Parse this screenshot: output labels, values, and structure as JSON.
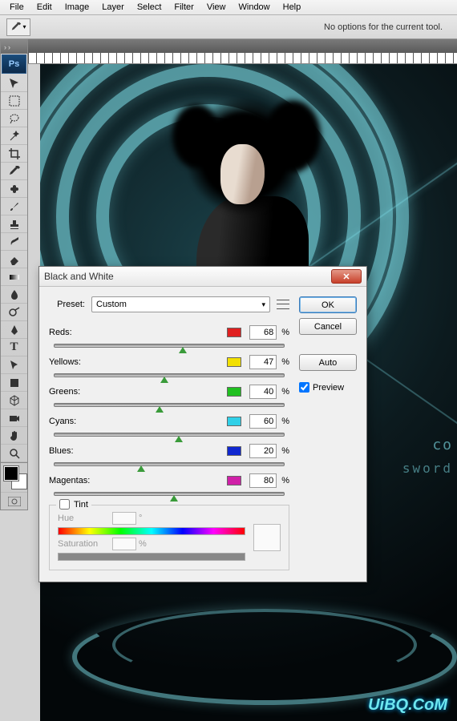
{
  "menu": [
    "File",
    "Edit",
    "Image",
    "Layer",
    "Select",
    "Filter",
    "View",
    "Window",
    "Help"
  ],
  "optionsBar": {
    "message": "No options for the current tool."
  },
  "dialog": {
    "title": "Black and White",
    "preset_label": "Preset:",
    "preset_value": "Custom",
    "rows": [
      {
        "label": "Reds:",
        "value": "68",
        "color": "#e02020"
      },
      {
        "label": "Yellows:",
        "value": "47",
        "color": "#f2e000"
      },
      {
        "label": "Greens:",
        "value": "40",
        "color": "#20c020"
      },
      {
        "label": "Cyans:",
        "value": "60",
        "color": "#30d0e8"
      },
      {
        "label": "Blues:",
        "value": "20",
        "color": "#1028d0"
      },
      {
        "label": "Magentas:",
        "value": "80",
        "color": "#d020a8"
      }
    ],
    "percent": "%",
    "tint_label": "Tint",
    "hue_label": "Hue",
    "sat_label": "Saturation",
    "degree": "°",
    "ok": "OK",
    "cancel": "Cancel",
    "auto": "Auto",
    "preview": "Preview"
  },
  "artwork": {
    "text1": "co",
    "text2": "sword",
    "watermark": "UiBQ.CoM"
  },
  "thumb_pos": {
    "Reds:": 56,
    "Yellows:": 48,
    "Greens:": 46,
    "Cyans:": 54,
    "Blues:": 38,
    "Magentas:": 52
  }
}
